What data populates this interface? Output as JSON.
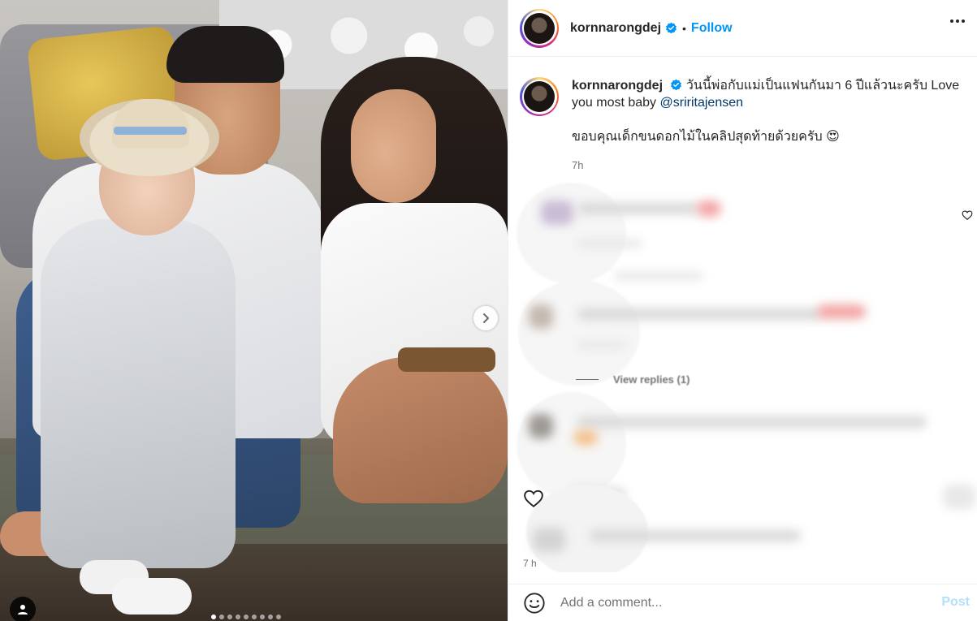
{
  "post": {
    "username": "kornnarongdej",
    "follow_label": "Follow",
    "separator": "•",
    "caption_text": "วันนี้พ่อกับแม่เป็นแฟนกันมา 6 ปีแล้วนะครับ Love you most baby",
    "mention": "@sriritajensen",
    "caption_line2": "ขอบคุณเด็กขนดอกไม้ในคลิปสุดท้ายด้วยครับ 😍",
    "time": "7h",
    "view_replies": "View replies (1)",
    "time_small": "7 h",
    "carousel_dots": 9,
    "active_dot": 0
  },
  "composer": {
    "placeholder": "Add a comment...",
    "post_label": "Post"
  },
  "colors": {
    "follow": "#0095f6",
    "verified": "#0095f6",
    "post_disabled": "#b2dffc",
    "mention": "#00376b"
  },
  "icons": [
    "verified-badge-icon",
    "more-options-icon",
    "next-arrow-icon",
    "user-tag-icon",
    "heart-icon",
    "emoji-icon"
  ]
}
